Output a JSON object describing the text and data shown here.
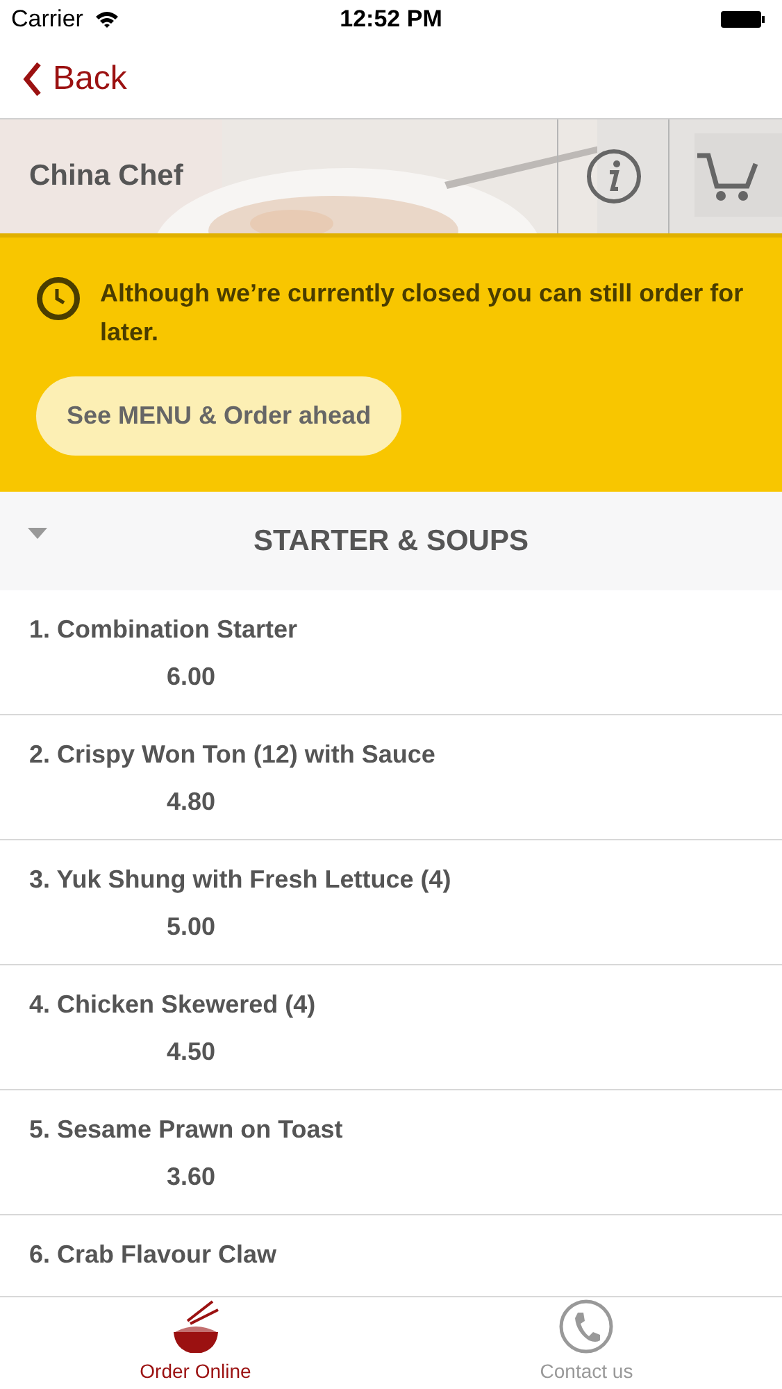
{
  "status_bar": {
    "carrier": "Carrier",
    "time": "12:52 PM"
  },
  "nav": {
    "back": "Back"
  },
  "header": {
    "title": "China Chef"
  },
  "notice": {
    "text": "Although we’re currently closed you can still order for later.",
    "button": "See MENU & Order ahead"
  },
  "section": {
    "title": "STARTER & SOUPS",
    "expanded": true
  },
  "items": [
    {
      "name": "1. Combination Starter",
      "price": "6.00"
    },
    {
      "name": "2. Crispy Won Ton (12) with Sauce",
      "price": "4.80"
    },
    {
      "name": "3. Yuk Shung with Fresh Lettuce (4)",
      "price": "5.00"
    },
    {
      "name": "4. Chicken Skewered (4)",
      "price": "4.50"
    },
    {
      "name": "5. Sesame Prawn on Toast",
      "price": "3.60"
    },
    {
      "name": "6. Crab Flavour Claw"
    }
  ],
  "tabs": [
    {
      "label": "Order Online",
      "kind": "bowl",
      "selected": true
    },
    {
      "label": "Contact us",
      "kind": "phone",
      "selected": false
    }
  ]
}
